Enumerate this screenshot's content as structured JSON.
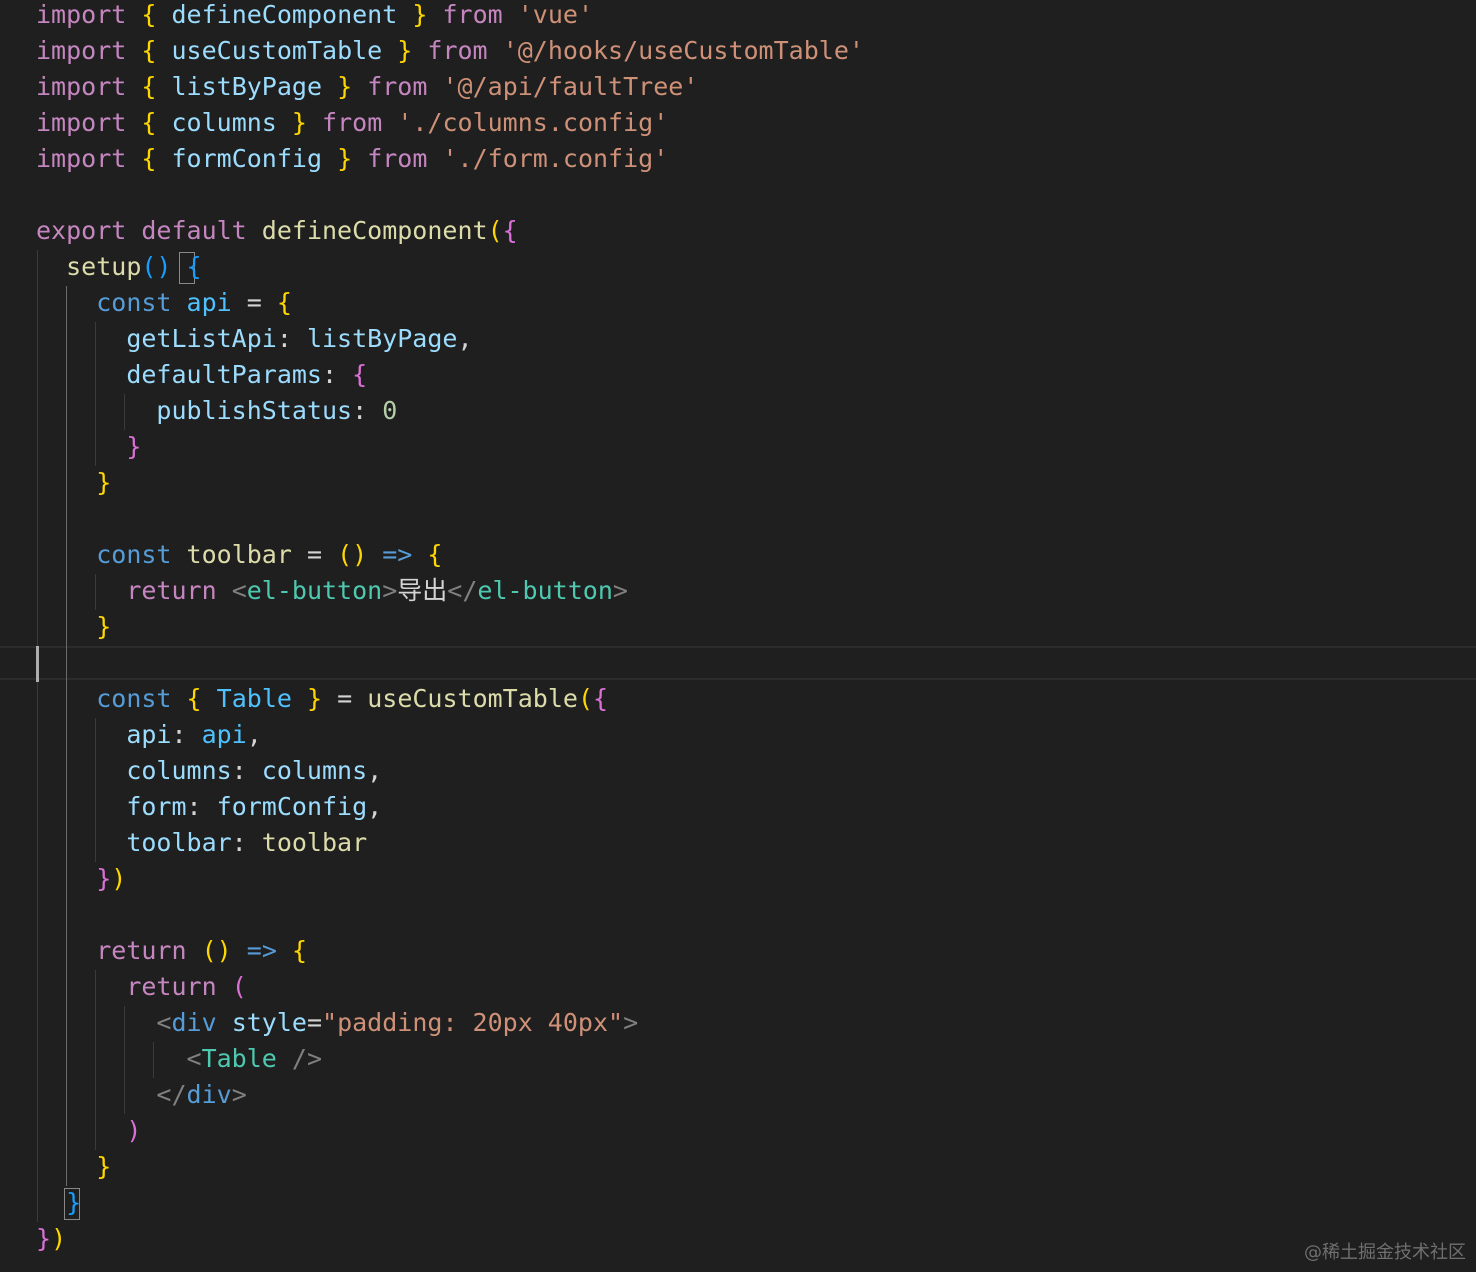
{
  "theme": {
    "background": "#1f1f1f",
    "colors": {
      "kw": "#c586c0",
      "storage": "#569cd6",
      "fn": "#dcdcaa",
      "var": "#9cdcfe",
      "const": "#4fc1ff",
      "str": "#ce9178",
      "num": "#b5cea8",
      "tag": "#4ec9b0",
      "tagName": "#569cd6",
      "angle": "#808080",
      "punc": "#d4d4d4",
      "b1": "#ffd700",
      "b2": "#da70d6",
      "b3": "#179fff"
    }
  },
  "watermark": "@稀土掘金技术社区",
  "code_lines": [
    [
      [
        "kw",
        "import"
      ],
      [
        "punc",
        " "
      ],
      [
        "b1",
        "{"
      ],
      [
        "punc",
        " "
      ],
      [
        "var",
        "defineComponent"
      ],
      [
        "punc",
        " "
      ],
      [
        "b1",
        "}"
      ],
      [
        "punc",
        " "
      ],
      [
        "kw",
        "from"
      ],
      [
        "punc",
        " "
      ],
      [
        "str",
        "'vue'"
      ]
    ],
    [
      [
        "kw",
        "import"
      ],
      [
        "punc",
        " "
      ],
      [
        "b1",
        "{"
      ],
      [
        "punc",
        " "
      ],
      [
        "var",
        "useCustomTable"
      ],
      [
        "punc",
        " "
      ],
      [
        "b1",
        "}"
      ],
      [
        "punc",
        " "
      ],
      [
        "kw",
        "from"
      ],
      [
        "punc",
        " "
      ],
      [
        "str",
        "'@/hooks/useCustomTable'"
      ]
    ],
    [
      [
        "kw",
        "import"
      ],
      [
        "punc",
        " "
      ],
      [
        "b1",
        "{"
      ],
      [
        "punc",
        " "
      ],
      [
        "var",
        "listByPage"
      ],
      [
        "punc",
        " "
      ],
      [
        "b1",
        "}"
      ],
      [
        "punc",
        " "
      ],
      [
        "kw",
        "from"
      ],
      [
        "punc",
        " "
      ],
      [
        "str",
        "'@/api/faultTree'"
      ]
    ],
    [
      [
        "kw",
        "import"
      ],
      [
        "punc",
        " "
      ],
      [
        "b1",
        "{"
      ],
      [
        "punc",
        " "
      ],
      [
        "var",
        "columns"
      ],
      [
        "punc",
        " "
      ],
      [
        "b1",
        "}"
      ],
      [
        "punc",
        " "
      ],
      [
        "kw",
        "from"
      ],
      [
        "punc",
        " "
      ],
      [
        "str",
        "'./columns.config'"
      ]
    ],
    [
      [
        "kw",
        "import"
      ],
      [
        "punc",
        " "
      ],
      [
        "b1",
        "{"
      ],
      [
        "punc",
        " "
      ],
      [
        "var",
        "formConfig"
      ],
      [
        "punc",
        " "
      ],
      [
        "b1",
        "}"
      ],
      [
        "punc",
        " "
      ],
      [
        "kw",
        "from"
      ],
      [
        "punc",
        " "
      ],
      [
        "str",
        "'./form.config'"
      ]
    ],
    [],
    [
      [
        "kw",
        "export"
      ],
      [
        "punc",
        " "
      ],
      [
        "kw",
        "default"
      ],
      [
        "punc",
        " "
      ],
      [
        "fn",
        "defineComponent"
      ],
      [
        "b1",
        "("
      ],
      [
        "b2",
        "{"
      ]
    ],
    [
      [
        "punc",
        "  "
      ],
      [
        "fn",
        "setup"
      ],
      [
        "b3",
        "()"
      ],
      [
        "punc",
        " "
      ],
      [
        "b3",
        "{"
      ]
    ],
    [
      [
        "punc",
        "    "
      ],
      [
        "storage",
        "const"
      ],
      [
        "punc",
        " "
      ],
      [
        "const",
        "api"
      ],
      [
        "punc",
        " = "
      ],
      [
        "b1",
        "{"
      ]
    ],
    [
      [
        "punc",
        "      "
      ],
      [
        "var",
        "getListApi"
      ],
      [
        "punc",
        ": "
      ],
      [
        "var",
        "listByPage"
      ],
      [
        "punc",
        ","
      ]
    ],
    [
      [
        "punc",
        "      "
      ],
      [
        "var",
        "defaultParams"
      ],
      [
        "punc",
        ": "
      ],
      [
        "b2",
        "{"
      ]
    ],
    [
      [
        "punc",
        "        "
      ],
      [
        "var",
        "publishStatus"
      ],
      [
        "punc",
        ": "
      ],
      [
        "num",
        "0"
      ]
    ],
    [
      [
        "punc",
        "      "
      ],
      [
        "b2",
        "}"
      ]
    ],
    [
      [
        "punc",
        "    "
      ],
      [
        "b1",
        "}"
      ]
    ],
    [],
    [
      [
        "punc",
        "    "
      ],
      [
        "storage",
        "const"
      ],
      [
        "punc",
        " "
      ],
      [
        "fn",
        "toolbar"
      ],
      [
        "punc",
        " = "
      ],
      [
        "b1",
        "()"
      ],
      [
        "punc",
        " "
      ],
      [
        "storage",
        "=>"
      ],
      [
        "punc",
        " "
      ],
      [
        "b1",
        "{"
      ]
    ],
    [
      [
        "punc",
        "      "
      ],
      [
        "kw",
        "return"
      ],
      [
        "punc",
        " "
      ],
      [
        "angle",
        "<"
      ],
      [
        "tag",
        "el-button"
      ],
      [
        "angle",
        ">"
      ],
      [
        "punc",
        "导出"
      ],
      [
        "angle",
        "</"
      ],
      [
        "tag",
        "el-button"
      ],
      [
        "angle",
        ">"
      ]
    ],
    [
      [
        "punc",
        "    "
      ],
      [
        "b1",
        "}"
      ]
    ],
    [],
    [
      [
        "punc",
        "    "
      ],
      [
        "storage",
        "const"
      ],
      [
        "punc",
        " "
      ],
      [
        "b1",
        "{"
      ],
      [
        "punc",
        " "
      ],
      [
        "const",
        "Table"
      ],
      [
        "punc",
        " "
      ],
      [
        "b1",
        "}"
      ],
      [
        "punc",
        " = "
      ],
      [
        "fn",
        "useCustomTable"
      ],
      [
        "b1",
        "("
      ],
      [
        "b2",
        "{"
      ]
    ],
    [
      [
        "punc",
        "      "
      ],
      [
        "var",
        "api"
      ],
      [
        "punc",
        ": "
      ],
      [
        "const",
        "api"
      ],
      [
        "punc",
        ","
      ]
    ],
    [
      [
        "punc",
        "      "
      ],
      [
        "var",
        "columns"
      ],
      [
        "punc",
        ": "
      ],
      [
        "var",
        "columns"
      ],
      [
        "punc",
        ","
      ]
    ],
    [
      [
        "punc",
        "      "
      ],
      [
        "var",
        "form"
      ],
      [
        "punc",
        ": "
      ],
      [
        "var",
        "formConfig"
      ],
      [
        "punc",
        ","
      ]
    ],
    [
      [
        "punc",
        "      "
      ],
      [
        "var",
        "toolbar"
      ],
      [
        "punc",
        ": "
      ],
      [
        "fn",
        "toolbar"
      ]
    ],
    [
      [
        "punc",
        "    "
      ],
      [
        "b2",
        "}"
      ],
      [
        "b1",
        ")"
      ]
    ],
    [],
    [
      [
        "punc",
        "    "
      ],
      [
        "kw",
        "return"
      ],
      [
        "punc",
        " "
      ],
      [
        "b1",
        "()"
      ],
      [
        "punc",
        " "
      ],
      [
        "storage",
        "=>"
      ],
      [
        "punc",
        " "
      ],
      [
        "b1",
        "{"
      ]
    ],
    [
      [
        "punc",
        "      "
      ],
      [
        "kw",
        "return"
      ],
      [
        "punc",
        " "
      ],
      [
        "b2",
        "("
      ]
    ],
    [
      [
        "punc",
        "        "
      ],
      [
        "angle",
        "<"
      ],
      [
        "tagName",
        "div"
      ],
      [
        "punc",
        " "
      ],
      [
        "var",
        "style"
      ],
      [
        "punc",
        "="
      ],
      [
        "str",
        "\"padding: 20px 40px\""
      ],
      [
        "angle",
        ">"
      ]
    ],
    [
      [
        "punc",
        "          "
      ],
      [
        "angle",
        "<"
      ],
      [
        "tag",
        "Table"
      ],
      [
        "punc",
        " "
      ],
      [
        "angle",
        "/>"
      ]
    ],
    [
      [
        "punc",
        "        "
      ],
      [
        "angle",
        "</"
      ],
      [
        "tagName",
        "div"
      ],
      [
        "angle",
        ">"
      ]
    ],
    [
      [
        "punc",
        "      "
      ],
      [
        "b2",
        ")"
      ]
    ],
    [
      [
        "punc",
        "    "
      ],
      [
        "b1",
        "}"
      ]
    ],
    [
      [
        "punc",
        "  "
      ],
      [
        "b3",
        "}"
      ]
    ],
    [
      [
        "b2",
        "}"
      ],
      [
        "b1",
        ")"
      ]
    ]
  ]
}
